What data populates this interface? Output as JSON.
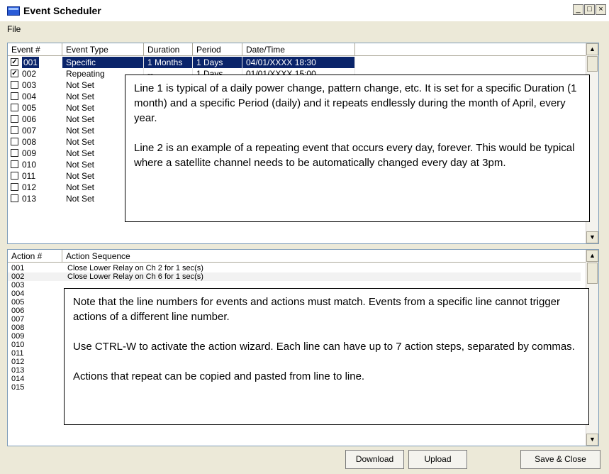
{
  "window": {
    "title": "Event Scheduler",
    "controls": {
      "minimize": "_",
      "maximize": "□",
      "close": "×"
    }
  },
  "menu": {
    "file": "File"
  },
  "events": {
    "headers": [
      "Event #",
      "Event Type",
      "Duration",
      "Period",
      "Date/Time"
    ],
    "rows": [
      {
        "num": "001",
        "checked": true,
        "type": "Specific",
        "duration": "1 Months",
        "period": "1 Days",
        "datetime": "04/01/XXXX 18:30"
      },
      {
        "num": "002",
        "checked": true,
        "type": "Repeating",
        "duration": "--",
        "period": "1 Days",
        "datetime": "01/01/XXXX 15:00"
      },
      {
        "num": "003",
        "checked": false,
        "type": "Not Set",
        "duration": "",
        "period": "",
        "datetime": ""
      },
      {
        "num": "004",
        "checked": false,
        "type": "Not Set",
        "duration": "",
        "period": "",
        "datetime": ""
      },
      {
        "num": "005",
        "checked": false,
        "type": "Not Set",
        "duration": "",
        "period": "",
        "datetime": ""
      },
      {
        "num": "006",
        "checked": false,
        "type": "Not Set",
        "duration": "",
        "period": "",
        "datetime": ""
      },
      {
        "num": "007",
        "checked": false,
        "type": "Not Set",
        "duration": "",
        "period": "",
        "datetime": ""
      },
      {
        "num": "008",
        "checked": false,
        "type": "Not Set",
        "duration": "",
        "period": "",
        "datetime": ""
      },
      {
        "num": "009",
        "checked": false,
        "type": "Not Set",
        "duration": "",
        "period": "",
        "datetime": ""
      },
      {
        "num": "010",
        "checked": false,
        "type": "Not Set",
        "duration": "",
        "period": "",
        "datetime": ""
      },
      {
        "num": "011",
        "checked": false,
        "type": "Not Set",
        "duration": "",
        "period": "",
        "datetime": ""
      },
      {
        "num": "012",
        "checked": false,
        "type": "Not Set",
        "duration": "",
        "period": "",
        "datetime": ""
      },
      {
        "num": "013",
        "checked": false,
        "type": "Not Set",
        "duration": "",
        "period": "",
        "datetime": ""
      }
    ]
  },
  "actions": {
    "headers": [
      "Action #",
      "Action Sequence"
    ],
    "rows": [
      {
        "num": "001",
        "text": "Close Lower Relay on Ch 2 for 1 sec(s)"
      },
      {
        "num": "002",
        "text": "Close Lower Relay on Ch 6 for 1 sec(s)"
      },
      {
        "num": "003",
        "text": ""
      },
      {
        "num": "004",
        "text": ""
      },
      {
        "num": "005",
        "text": ""
      },
      {
        "num": "006",
        "text": ""
      },
      {
        "num": "007",
        "text": ""
      },
      {
        "num": "008",
        "text": ""
      },
      {
        "num": "009",
        "text": ""
      },
      {
        "num": "010",
        "text": ""
      },
      {
        "num": "011",
        "text": ""
      },
      {
        "num": "012",
        "text": ""
      },
      {
        "num": "013",
        "text": ""
      },
      {
        "num": "014",
        "text": ""
      },
      {
        "num": "015",
        "text": ""
      }
    ]
  },
  "notes": {
    "events": [
      "Line 1 is typical of a daily power change, pattern change, etc.  It is set for a specific Duration (1 month) and a specific Period (daily) and it repeats endlessly during the month of April, every year.",
      "Line 2 is an example of a repeating event that occurs every day, forever.  This would be typical where a satellite channel needs to be automatically changed every day at 3pm."
    ],
    "actions": [
      "Note that the line numbers for events and actions must match.  Events from a specific line cannot trigger actions of a different line number.",
      "Use CTRL-W to activate the action  wizard.  Each line can have up to 7 action steps, separated by commas.",
      "Actions that repeat can be copied and pasted from line to line."
    ]
  },
  "buttons": {
    "download": "Download",
    "upload": "Upload",
    "save_close": "Save & Close"
  }
}
